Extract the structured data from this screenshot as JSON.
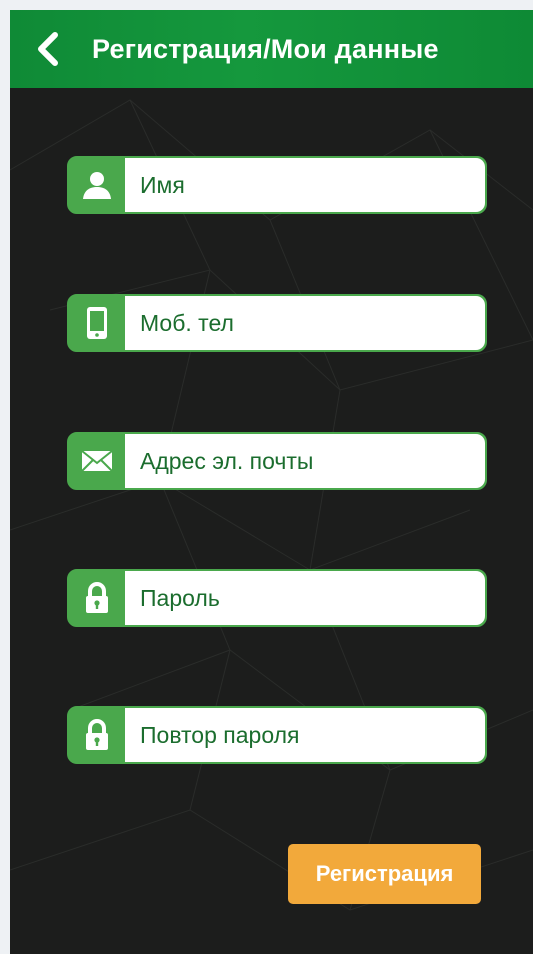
{
  "header": {
    "title": "Регистрация/Мои данные",
    "back_icon": "chevron-left-icon"
  },
  "form": {
    "fields": [
      {
        "placeholder": "Имя",
        "icon": "user-icon"
      },
      {
        "placeholder": "Моб. тел",
        "icon": "mobile-phone-icon"
      },
      {
        "placeholder": "Адрес эл. почты",
        "icon": "envelope-icon"
      },
      {
        "placeholder": "Пароль",
        "icon": "lock-icon"
      },
      {
        "placeholder": "Повтор пароля",
        "icon": "lock-icon"
      }
    ],
    "submit_label": "Регистрация"
  },
  "colors": {
    "header_green": "#15983d",
    "field_green": "#4aa84c",
    "text_green": "#1b6d2e",
    "background": "#1c1d1c",
    "button_orange": "#f2a93b"
  }
}
